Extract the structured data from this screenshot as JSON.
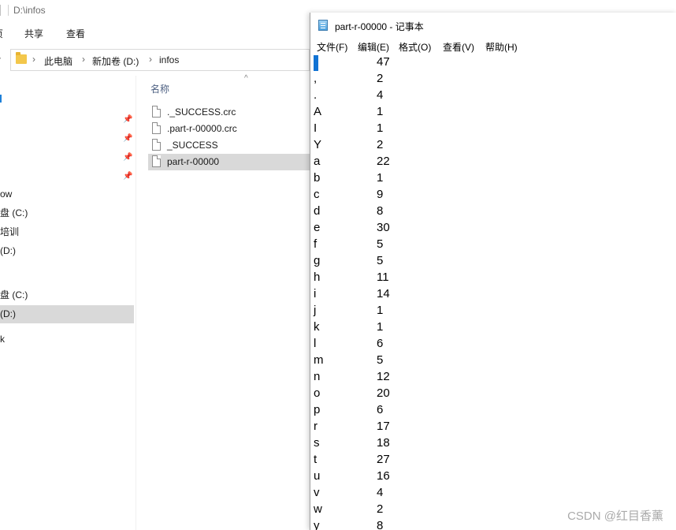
{
  "explorer": {
    "title_path": "D:\\infos",
    "ribbon_tabs": [
      "共享",
      "查看"
    ],
    "ribbon_partial_tab": "页",
    "up_arrow": "↑",
    "breadcrumbs": [
      "此电脑",
      "新加卷 (D:)",
      "infos"
    ],
    "nav_items": [
      {
        "label": "ow",
        "selected": false
      },
      {
        "label": "盘 (C:)",
        "selected": false
      },
      {
        "label": "培训",
        "selected": false
      },
      {
        "label": "(D:)",
        "selected": false
      },
      {
        "label": "盘 (C:)",
        "selected": false
      },
      {
        "label": "(D:)",
        "selected": true
      },
      {
        "label": "k",
        "selected": false
      }
    ],
    "column_header": "名称",
    "files": [
      {
        "name": "._SUCCESS.crc",
        "selected": false
      },
      {
        "name": ".part-r-00000.crc",
        "selected": false
      },
      {
        "name": "_SUCCESS",
        "selected": false
      },
      {
        "name": "part-r-00000",
        "selected": true
      }
    ]
  },
  "notepad": {
    "title": "part-r-00000 - 记事本",
    "menu": [
      "文件(F)",
      "编辑(E)",
      "格式(O)",
      "查看(V)",
      "帮助(H)"
    ],
    "lines": [
      {
        "ch": "",
        "count": "47"
      },
      {
        "ch": ",",
        "count": "2"
      },
      {
        "ch": ".",
        "count": "4"
      },
      {
        "ch": "A",
        "count": "1"
      },
      {
        "ch": "I",
        "count": "1"
      },
      {
        "ch": "Y",
        "count": "2"
      },
      {
        "ch": "a",
        "count": "22"
      },
      {
        "ch": "b",
        "count": "1"
      },
      {
        "ch": "c",
        "count": "9"
      },
      {
        "ch": "d",
        "count": "8"
      },
      {
        "ch": "e",
        "count": "30"
      },
      {
        "ch": "f",
        "count": "5"
      },
      {
        "ch": "g",
        "count": "5"
      },
      {
        "ch": "h",
        "count": "11"
      },
      {
        "ch": "i",
        "count": "14"
      },
      {
        "ch": "j",
        "count": "1"
      },
      {
        "ch": "k",
        "count": "1"
      },
      {
        "ch": "l",
        "count": "6"
      },
      {
        "ch": "m",
        "count": "5"
      },
      {
        "ch": "n",
        "count": "12"
      },
      {
        "ch": "o",
        "count": "20"
      },
      {
        "ch": "p",
        "count": "6"
      },
      {
        "ch": "r",
        "count": "17"
      },
      {
        "ch": "s",
        "count": "18"
      },
      {
        "ch": "t",
        "count": "27"
      },
      {
        "ch": "u",
        "count": "16"
      },
      {
        "ch": "v",
        "count": "4"
      },
      {
        "ch": "w",
        "count": "2"
      },
      {
        "ch": "y",
        "count": "8"
      }
    ]
  },
  "watermark": "CSDN @红目香薰"
}
